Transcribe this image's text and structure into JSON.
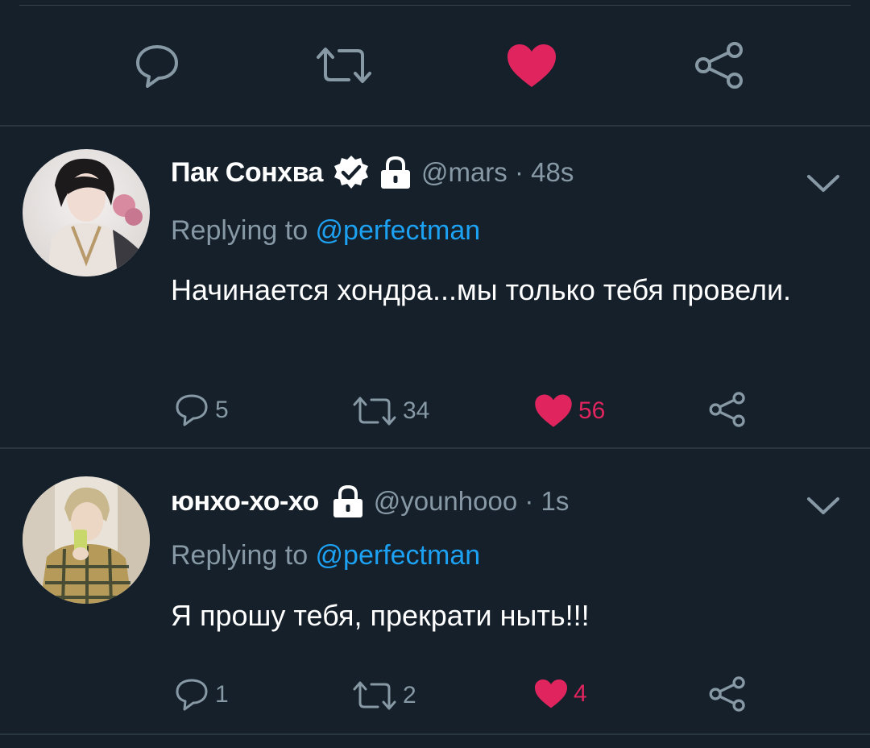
{
  "colors": {
    "background": "#15202b",
    "secondary_text": "#8899a6",
    "link": "#1da1f2",
    "like": "#e0245e",
    "divider": "#2a3640"
  },
  "main_tweet_actions": {
    "reply_icon": "reply-icon",
    "retweet_icon": "retweet-icon",
    "like_icon": "heart-filled-icon",
    "share_icon": "share-icon",
    "liked": true
  },
  "replies": [
    {
      "name": "Пак Сонхва",
      "verified": true,
      "protected": true,
      "handle_time": "@mars · 48s",
      "replying_prefix": "Replying to ",
      "replying_to": "@perfectman",
      "text": "Начинается хондра...мы только тебя провели.",
      "reply_count": "5",
      "retweet_count": "34",
      "like_count": "56",
      "liked": true
    },
    {
      "name": "юнхо-хо-хо",
      "verified": false,
      "protected": true,
      "handle_time": "@younhooo · 1s",
      "replying_prefix": "Replying to ",
      "replying_to": "@perfectman",
      "text": "Я прошу тебя, прекрати ныть!!!",
      "reply_count": "1",
      "retweet_count": "2",
      "like_count": "4",
      "liked": true
    }
  ]
}
